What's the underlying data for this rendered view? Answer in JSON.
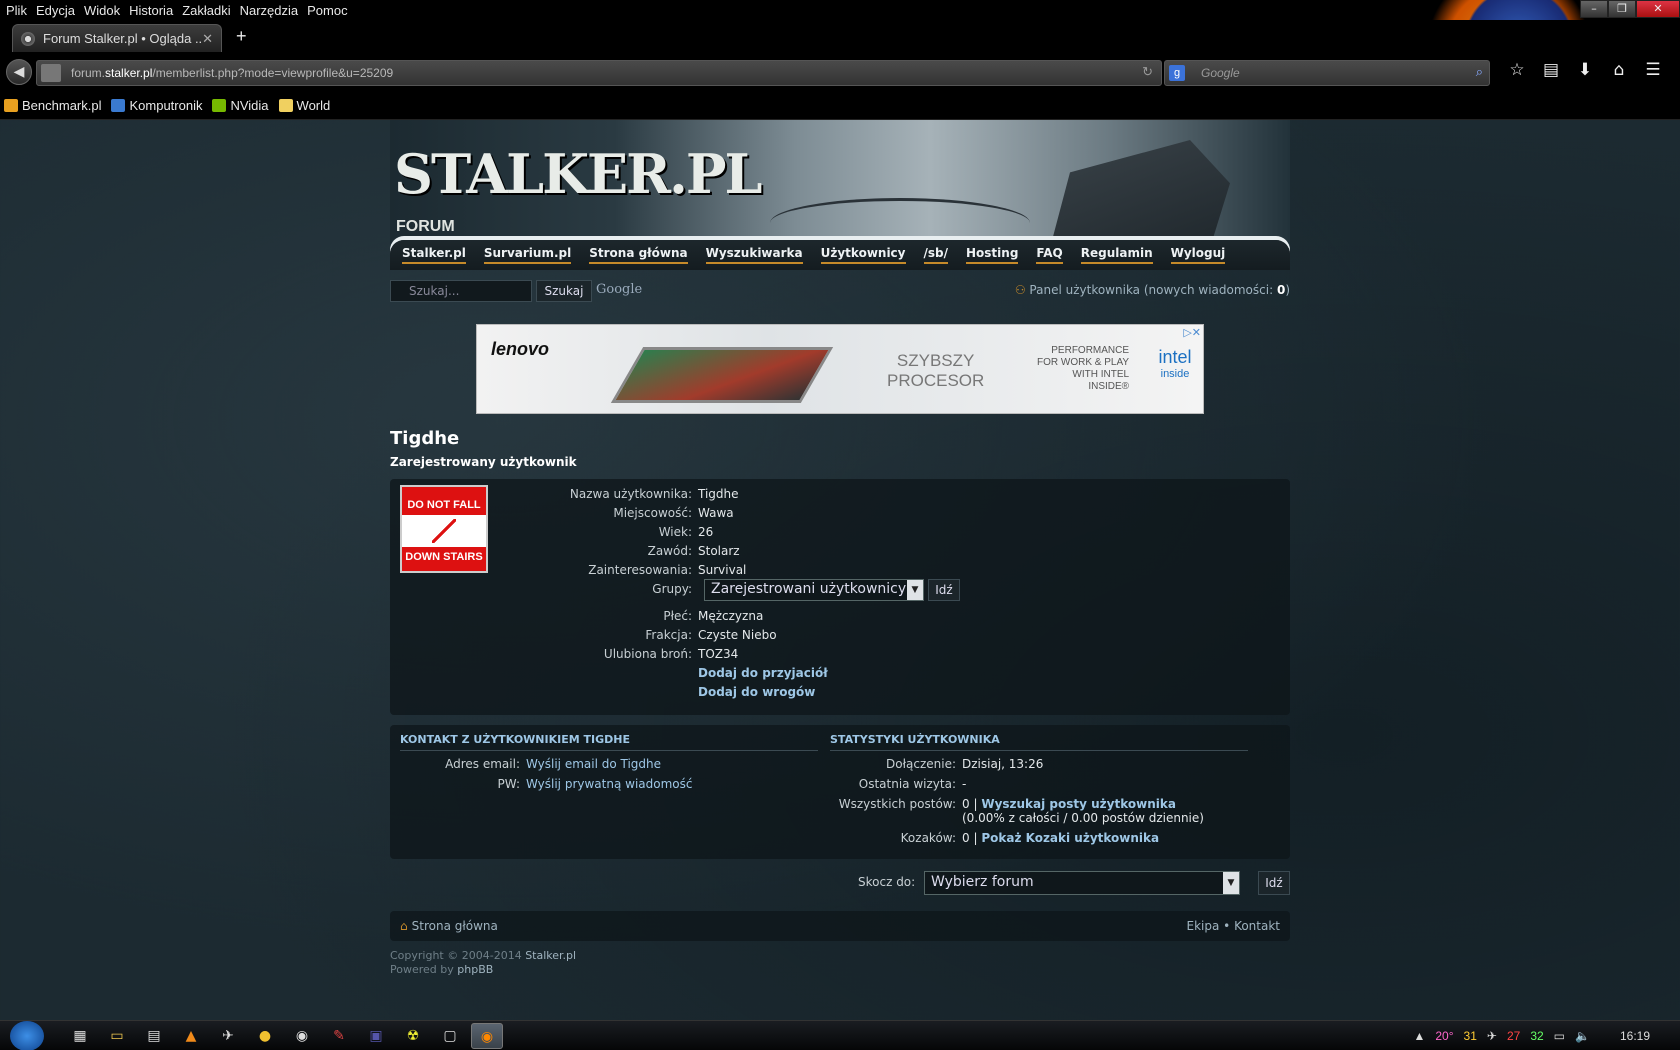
{
  "browser": {
    "menu": [
      "Plik",
      "Edycja",
      "Widok",
      "Historia",
      "Zakładki",
      "Narzędzia",
      "Pomoc"
    ],
    "tab_title": "Forum Stalker.pl • Ogląda ...",
    "url_prefix": "forum.",
    "url_domain": "stalker.pl",
    "url_path": "/memberlist.php?mode=viewprofile&u=25209",
    "search_placeholder": "Google",
    "bookmarks": [
      {
        "label": "Benchmark.pl",
        "color": "#e8a020"
      },
      {
        "label": "Komputronik",
        "color": "#3a7ad0"
      },
      {
        "label": "NVidia",
        "color": "#76b900"
      },
      {
        "label": "World",
        "color": "#f0d060"
      }
    ]
  },
  "header": {
    "logo": "STALKER.PL",
    "logo_sub": "FORUM"
  },
  "nav": [
    "Stalker.pl",
    "Survarium.pl",
    "Strona główna",
    "Wyszukiwarka",
    "Użytkownicy",
    "/sb/",
    "Hosting",
    "FAQ",
    "Regulamin",
    "Wyloguj"
  ],
  "toolbar": {
    "search_placeholder": "Szukaj...",
    "search_button": "Szukaj",
    "google": "Google",
    "ucp_label": "Panel użytkownika (nowych wiadomości: ",
    "ucp_count": "0",
    "ucp_close": ")"
  },
  "ad": {
    "brand": "lenovo",
    "tagline_1": "SZYBSZY",
    "tagline_2": "PROCESOR",
    "perf_1": "PERFORMANCE",
    "perf_2": "FOR WORK & PLAY",
    "perf_3": "WITH INTEL",
    "perf_4": "INSIDE®",
    "intel": "intel",
    "intel_sub": "inside"
  },
  "profile": {
    "username": "Tigdhe",
    "rank": "Zarejestrowany użytkownik",
    "avatar_top": "DO NOT FALL",
    "avatar_bottom": "DOWN STAIRS",
    "fields": [
      {
        "k": "Nazwa użytkownika:",
        "v": "Tigdhe"
      },
      {
        "k": "Miejscowość:",
        "v": "Wawa"
      },
      {
        "k": "Wiek:",
        "v": "26"
      },
      {
        "k": "Zawód:",
        "v": "Stolarz"
      },
      {
        "k": "Zainteresowania:",
        "v": "Survival"
      }
    ],
    "groups_label": "Grupy:",
    "groups_value": "Zarejestrowani użytkownicy",
    "groups_button": "Idź",
    "fields2": [
      {
        "k": "Płeć:",
        "v": "Mężczyzna"
      },
      {
        "k": "Frakcja:",
        "v": "Czyste Niebo"
      },
      {
        "k": "Ulubiona broń:",
        "v": "TOZ34"
      }
    ],
    "add_friend": "Dodaj do przyjaciół",
    "add_foe": "Dodaj do wrogów"
  },
  "contact": {
    "title": "KONTAKT Z UŻYTKOWNIKIEM TIGDHE",
    "email_label": "Adres email:",
    "email_value": "Wyślij email do Tigdhe",
    "pm_label": "PW:",
    "pm_value": "Wyślij prywatną wiadomość"
  },
  "stats": {
    "title": "STATYSTYKI UŻYTKOWNIKA",
    "joined_label": "Dołączenie:",
    "joined_value": "Dzisiaj, 13:26",
    "last_label": "Ostatnia wizyta:",
    "last_value": "-",
    "posts_label": "Wszystkich postów:",
    "posts_count": "0 |",
    "posts_link": "Wyszukaj posty użytkownika",
    "posts_detail": "(0.00% z całości / 0.00 postów dziennie)",
    "kozaki_label": "Kozaków:",
    "kozaki_count": "0 |",
    "kozaki_link": "Pokaż Kozaki użytkownika"
  },
  "jump": {
    "label": "Skocz do:",
    "value": "Wybierz forum",
    "button": "Idź"
  },
  "footer": {
    "home": "Strona główna",
    "team": "Ekipa",
    "sep": "•",
    "contact": "Kontakt",
    "copy_text": "Copyright © 2004-2014 ",
    "copy_link": "Stalker.pl",
    "powered_text": "Powered by ",
    "powered_link": "phpBB"
  },
  "tray": {
    "temp": "20°",
    "a": "31",
    "b": "27",
    "c": "32",
    "clock": "16:19"
  }
}
